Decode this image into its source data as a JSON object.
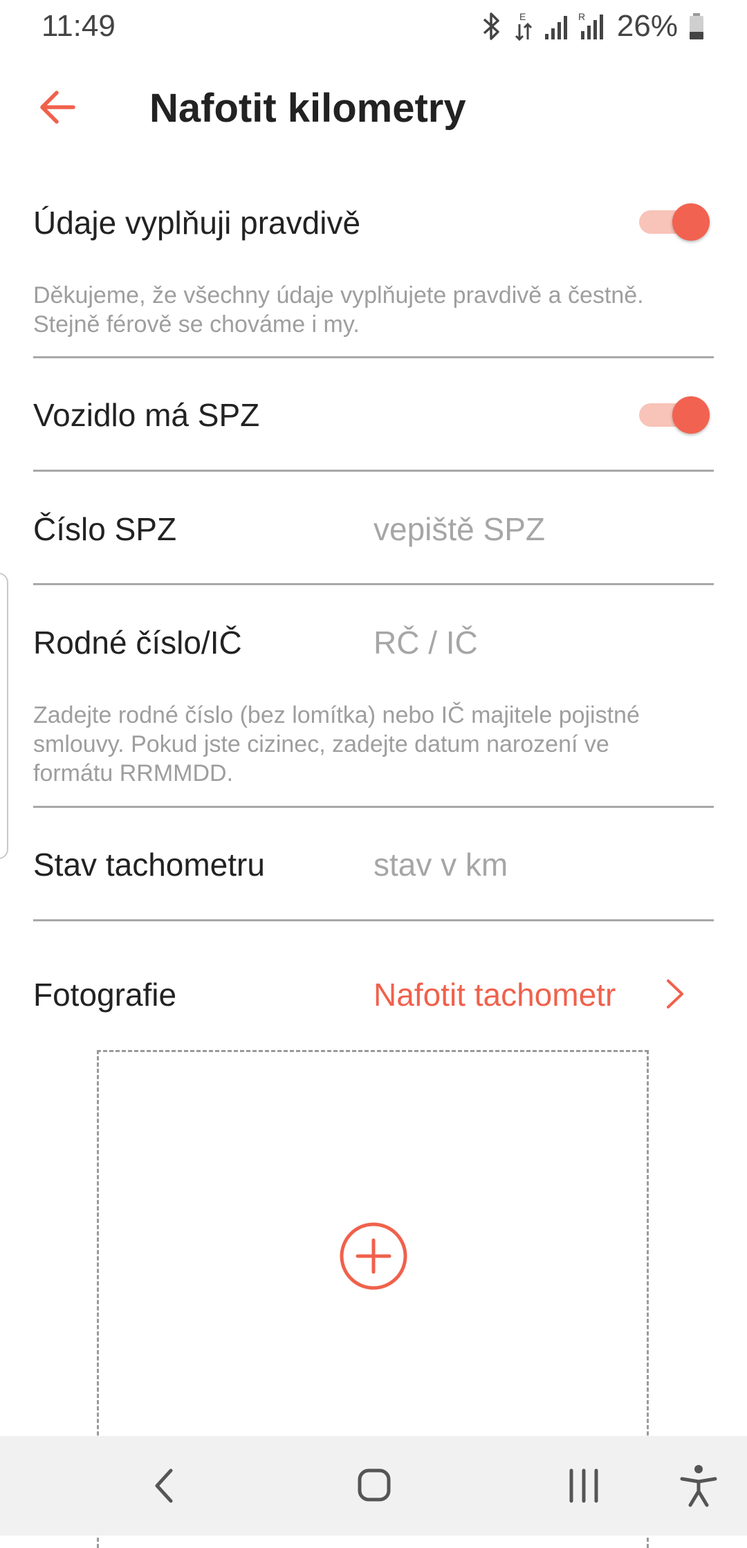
{
  "status_bar": {
    "time": "11:49",
    "battery": "26%",
    "icons": [
      "bluetooth-icon",
      "data-transfer-icon",
      "signal-icon",
      "signal-roaming-icon",
      "battery-icon"
    ]
  },
  "app_bar": {
    "title": "Nafotit kilometry",
    "back_icon": "arrow-left-icon"
  },
  "form": {
    "truthful": {
      "label": "Údaje vyplňuji pravdivě",
      "on": true,
      "help": [
        "Děkujeme, že všechny údaje vyplňujete pravdivě a čestně.",
        "Stejně férově se chováme i my."
      ]
    },
    "has_plate": {
      "label": "Vozidlo má SPZ",
      "on": true
    },
    "plate_number": {
      "label": "Číslo SPZ",
      "placeholder": "vepiště SPZ"
    },
    "birth_number": {
      "label": "Rodné číslo/IČ",
      "placeholder": "RČ / IČ",
      "help": [
        "Zadejte rodné číslo (bez lomítka) nebo IČ majitele pojistné",
        "smlouvy. Pokud jste cizinec, zadejte datum narození ve",
        "formátu RRMMDD."
      ]
    },
    "odometer": {
      "label": "Stav tachometru",
      "placeholder": "stav v km"
    },
    "photo": {
      "label": "Fotografie",
      "action": "Nafotit tachometr",
      "add_icon": "add-circle-icon"
    }
  },
  "nav_bar": {
    "icons": [
      "back-icon",
      "home-icon",
      "recents-icon",
      "accessibility-icon"
    ]
  },
  "colors": {
    "accent": "#f0614c",
    "toggle_track": "#f8c3b9",
    "divider": "#a8a8a8",
    "hint": "#a6a6a6"
  }
}
